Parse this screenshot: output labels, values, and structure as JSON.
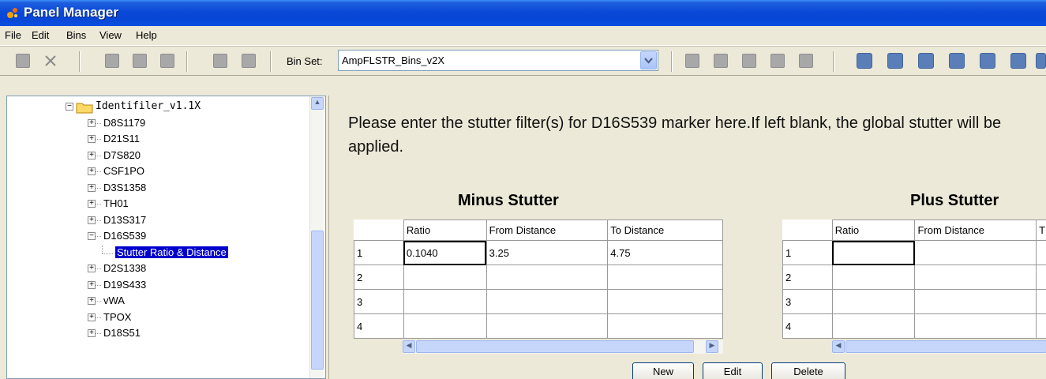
{
  "window": {
    "title": "Panel Manager"
  },
  "menu": [
    "File",
    "Edit",
    "Bins",
    "View",
    "Help"
  ],
  "toolbar": {
    "binset_label": "Bin Set:",
    "binset_value": "AmpFLSTR_Bins_v2X"
  },
  "tree": {
    "root": "Identifiler_v1.1X",
    "items": [
      {
        "label": "D8S1179",
        "expander": "+"
      },
      {
        "label": "D21S11",
        "expander": "+"
      },
      {
        "label": "D7S820",
        "expander": "+"
      },
      {
        "label": "CSF1PO",
        "expander": "+"
      },
      {
        "label": "D3S1358",
        "expander": "+"
      },
      {
        "label": "TH01",
        "expander": "+"
      },
      {
        "label": "D13S317",
        "expander": "+"
      },
      {
        "label": "D16S539",
        "expander": "−"
      },
      {
        "label": "Stutter Ratio & Distance",
        "expander": ""
      },
      {
        "label": "D2S1338",
        "expander": "+"
      },
      {
        "label": "D19S433",
        "expander": "+"
      },
      {
        "label": "vWA",
        "expander": "+"
      },
      {
        "label": "TPOX",
        "expander": "+"
      },
      {
        "label": "D18S51",
        "expander": "+"
      }
    ]
  },
  "content": {
    "prompt": "Please enter the stutter filter(s) for D16S539 marker here.If left blank, the global stutter will be applied.",
    "minus": {
      "title": "Minus Stutter",
      "columns": [
        "Ratio",
        "From Distance",
        "To Distance"
      ],
      "rows": [
        {
          "num": "1",
          "cells": [
            "0.1040",
            "3.25",
            "4.75"
          ]
        },
        {
          "num": "2",
          "cells": [
            "",
            "",
            ""
          ]
        },
        {
          "num": "3",
          "cells": [
            "",
            "",
            ""
          ]
        },
        {
          "num": "4",
          "cells": [
            "",
            "",
            ""
          ]
        }
      ]
    },
    "plus": {
      "title": "Plus Stutter",
      "columns": [
        "Ratio",
        "From Distance",
        "T"
      ],
      "rows": [
        {
          "num": "1",
          "cells": [
            "",
            "",
            ""
          ]
        },
        {
          "num": "2",
          "cells": [
            "",
            "",
            ""
          ]
        },
        {
          "num": "3",
          "cells": [
            "",
            "",
            ""
          ]
        },
        {
          "num": "4",
          "cells": [
            "",
            "",
            ""
          ]
        }
      ]
    },
    "buttons": {
      "new": "New",
      "edit": "Edit",
      "delete": "Delete"
    }
  },
  "colors": {
    "titlebar": "#0a4ad8",
    "selection": "#0000cc",
    "binset_border": "#7f9db9"
  }
}
